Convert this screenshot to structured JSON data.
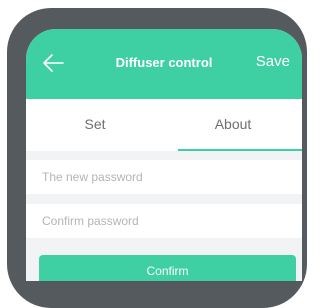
{
  "header": {
    "back_icon": "arrow-left-icon",
    "title": "Diffuser control",
    "save_label": "Save"
  },
  "tabs": [
    {
      "label": "Set",
      "active": false
    },
    {
      "label": "About",
      "active": true
    }
  ],
  "form": {
    "new_password_placeholder": "The new password",
    "confirm_password_placeholder": "Confirm password",
    "confirm_label": "Confirm"
  },
  "colors": {
    "accent": "#3ecfa3",
    "phone_frame": "#555a5f",
    "background": "#f2f3f5"
  }
}
